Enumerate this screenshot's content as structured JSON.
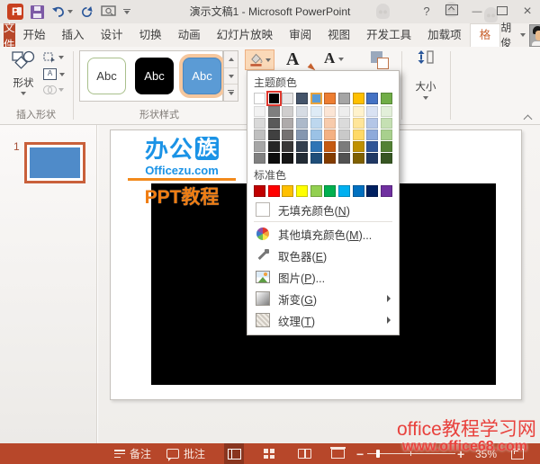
{
  "titlebar": {
    "title": "演示文稿1 - Microsoft PowerPoint",
    "help_glyph": "?",
    "minimize_glyph": "—",
    "close_glyph": "×"
  },
  "tabs": {
    "file": "文件",
    "list": [
      "开始",
      "插入",
      "设计",
      "切换",
      "动画",
      "幻灯片放映",
      "审阅",
      "视图",
      "开发工具",
      "加载项"
    ],
    "contextual": "格式",
    "user": "胡俊"
  },
  "ribbon": {
    "shapes_button": "形状",
    "insert_shapes_group": "插入形状",
    "shape_styles_group": "形状样式",
    "size_button": "大小",
    "gallery_chips": [
      {
        "label": "Abc",
        "bg": "#FFFFFF",
        "border": "#A9C08C",
        "fg": "#3b3b3b",
        "selected": false
      },
      {
        "label": "Abc",
        "bg": "#000000",
        "border": "#000000",
        "fg": "#FFFFFF",
        "selected": false
      },
      {
        "label": "Abc",
        "bg": "#5B9BD5",
        "border": "#4A87C0",
        "fg": "#FFFFFF",
        "selected": true
      }
    ]
  },
  "fill_menu": {
    "theme_label": "主题颜色",
    "standard_label": "标准色",
    "theme_colors": [
      "#FFFFFF",
      "#000000",
      "#E7E6E6",
      "#44546A",
      "#5B9BD5",
      "#ED7D31",
      "#A5A5A5",
      "#FFC000",
      "#4472C4",
      "#70AD47"
    ],
    "selected_index": 1,
    "current_fill_index": 4,
    "theme_tints": [
      [
        "#F2F2F2",
        "#D9D9D9",
        "#BFBFBF",
        "#A6A6A6",
        "#808080"
      ],
      [
        "#7F7F7F",
        "#595959",
        "#404040",
        "#262626",
        "#0D0D0D"
      ],
      [
        "#D0CECE",
        "#AEAAAA",
        "#757171",
        "#3A3838",
        "#161616"
      ],
      [
        "#D6DCE4",
        "#ACB9CA",
        "#8496B0",
        "#333F4F",
        "#222B35"
      ],
      [
        "#DEEBF6",
        "#BDD7EE",
        "#9BC2E6",
        "#2E74B5",
        "#1F4E79"
      ],
      [
        "#FBE5D5",
        "#F7CBAC",
        "#F4B183",
        "#C55A11",
        "#833C00"
      ],
      [
        "#EDEDED",
        "#DBDBDB",
        "#C9C9C9",
        "#7B7B7B",
        "#525252"
      ],
      [
        "#FFF2CC",
        "#FFE599",
        "#FFD966",
        "#BF9000",
        "#7F6000"
      ],
      [
        "#D9E2F3",
        "#B4C6E7",
        "#8EAADB",
        "#2F5496",
        "#1F3864"
      ],
      [
        "#E2EFD9",
        "#C5E0B3",
        "#A8D08D",
        "#538135",
        "#375623"
      ]
    ],
    "standard_colors": [
      "#C00000",
      "#FF0000",
      "#FFC000",
      "#FFFF00",
      "#92D050",
      "#00B050",
      "#00B0F0",
      "#0070C0",
      "#002060",
      "#7030A0"
    ],
    "items": [
      {
        "label": "无填充颜色(N)",
        "icon": "no-fill",
        "submenu": false
      },
      {
        "label": "其他填充颜色(M)...",
        "icon": "color-wheel",
        "submenu": false
      },
      {
        "label": "取色器(E)",
        "icon": "eyedropper",
        "submenu": false
      },
      {
        "label": "图片(P)...",
        "icon": "picture",
        "submenu": false
      },
      {
        "label": "渐变(G)",
        "icon": "gradient",
        "submenu": true
      },
      {
        "label": "纹理(T)",
        "icon": "texture",
        "submenu": true
      }
    ]
  },
  "slides_panel": {
    "slide_number": "1"
  },
  "statusbar": {
    "notes": "备注",
    "comments": "批注",
    "zoom_percent": "35%"
  },
  "watermarks": {
    "logo_cn": "办公",
    "logo_zu": "族",
    "logo_domain": "Officezu.com",
    "logo_tagline": "PPT教程",
    "footer_line1": "office教程学习网",
    "footer_line2": "www.office68.com"
  },
  "colors": {
    "accent": "#B7472A",
    "slide_fill_preview": "#000000",
    "thumbnail_shape_fill": "#4F8BC9",
    "selection_highlight": "#F5C79E",
    "selected_swatch_ring": "#E0382E",
    "current_fill_ring": "#E8A33D"
  }
}
